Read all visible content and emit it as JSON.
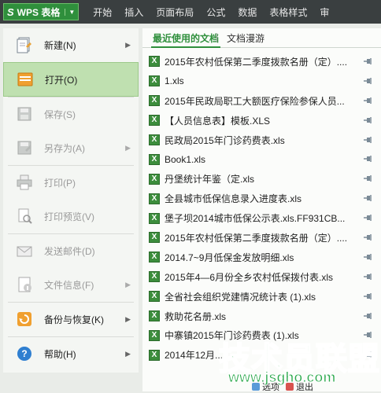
{
  "app": {
    "title": "WPS 表格"
  },
  "menu_tabs": [
    "开始",
    "插入",
    "页面布局",
    "公式",
    "数据",
    "表格样式",
    "审"
  ],
  "left_menu": [
    {
      "label": "新建(N)",
      "icon": "new-doc-icon",
      "arrow": true,
      "state": "normal"
    },
    {
      "label": "打开(O)",
      "icon": "open-folder-icon",
      "arrow": false,
      "state": "active"
    },
    {
      "label": "保存(S)",
      "icon": "save-icon",
      "arrow": false,
      "state": "disabled"
    },
    {
      "label": "另存为(A)",
      "icon": "save-as-icon",
      "arrow": true,
      "state": "disabled"
    },
    {
      "label": "打印(P)",
      "icon": "print-icon",
      "arrow": false,
      "state": "disabled"
    },
    {
      "label": "打印预览(V)",
      "icon": "print-preview-icon",
      "arrow": false,
      "state": "disabled"
    },
    {
      "label": "发送邮件(D)",
      "icon": "mail-icon",
      "arrow": false,
      "state": "disabled"
    },
    {
      "label": "文件信息(F)",
      "icon": "info-icon",
      "arrow": true,
      "state": "disabled"
    },
    {
      "label": "备份与恢复(K)",
      "icon": "backup-icon",
      "arrow": true,
      "state": "normal"
    },
    {
      "label": "帮助(H)",
      "icon": "help-icon",
      "arrow": true,
      "state": "normal"
    }
  ],
  "right_tabs": {
    "recent": "最近使用的文档",
    "roam": "文档漫游"
  },
  "files": [
    "2015年农村低保第二季度拨款名册（定）....",
    "1.xls",
    "2015年民政局职工大额医疗保险参保人员...",
    "【人员信息表】模板.XLS",
    "民政局2015年门诊药费表.xls",
    "Book1.xls",
    "丹堡统计年鉴（定.xls",
    "全县城市低保信息录入进度表.xls",
    "堡子坝2014城市低保公示表.xls.FF931CB...",
    "2015年农村低保第二季度拨款名册（定）....",
    "2014.7~9月低保金发放明细.xls",
    "2015年4—6月份全乡农村低保拨付表.xls",
    "全省社会组织党建情况统计表 (1).xls",
    "救助花名册.xls",
    "中寨镇2015年门诊药费表 (1).xls",
    "2014年12月..."
  ],
  "bottom_buttons": [
    "选项",
    "退出"
  ],
  "watermark": {
    "line1": "技术员联盟",
    "line2": "www.jsgho.com"
  },
  "colors": {
    "accent": "#2f8f3c",
    "active_bg": "#bfe0b0",
    "topbar": "#3a3f40"
  }
}
